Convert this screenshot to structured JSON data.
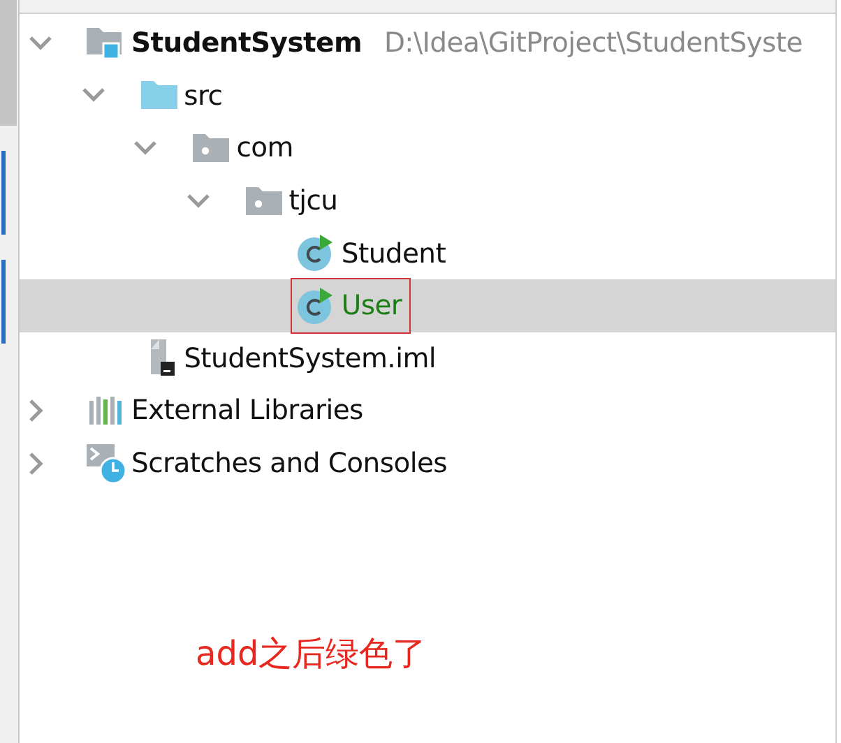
{
  "project_tree": [
    {
      "kind": "module",
      "label": "StudentSystem",
      "path": "D:\\Idea\\GitProject\\StudentSyste",
      "expanded": true,
      "selected": false,
      "vcs_added": false,
      "outlined": false,
      "children": [
        {
          "kind": "source-folder",
          "label": "src",
          "expanded": true,
          "selected": false,
          "vcs_added": false,
          "outlined": false,
          "children": [
            {
              "kind": "package",
              "label": "com",
              "expanded": true,
              "selected": false,
              "vcs_added": false,
              "outlined": false,
              "children": [
                {
                  "kind": "package",
                  "label": "tjcu",
                  "expanded": true,
                  "selected": false,
                  "vcs_added": false,
                  "outlined": false,
                  "children": [
                    {
                      "kind": "class",
                      "label": "Student",
                      "selected": false,
                      "vcs_added": false,
                      "outlined": false
                    },
                    {
                      "kind": "class",
                      "label": "User",
                      "selected": true,
                      "vcs_added": true,
                      "outlined": true
                    }
                  ]
                }
              ]
            }
          ]
        },
        {
          "kind": "iml",
          "label": "StudentSystem.iml",
          "selected": false,
          "vcs_added": false,
          "outlined": false
        }
      ]
    },
    {
      "kind": "libraries",
      "label": "External Libraries",
      "expanded": false,
      "selected": false,
      "vcs_added": false,
      "outlined": false
    },
    {
      "kind": "scratches",
      "label": "Scratches and Consoles",
      "expanded": false,
      "selected": false,
      "vcs_added": false,
      "outlined": false
    }
  ],
  "annotation": "add之后绿色了"
}
